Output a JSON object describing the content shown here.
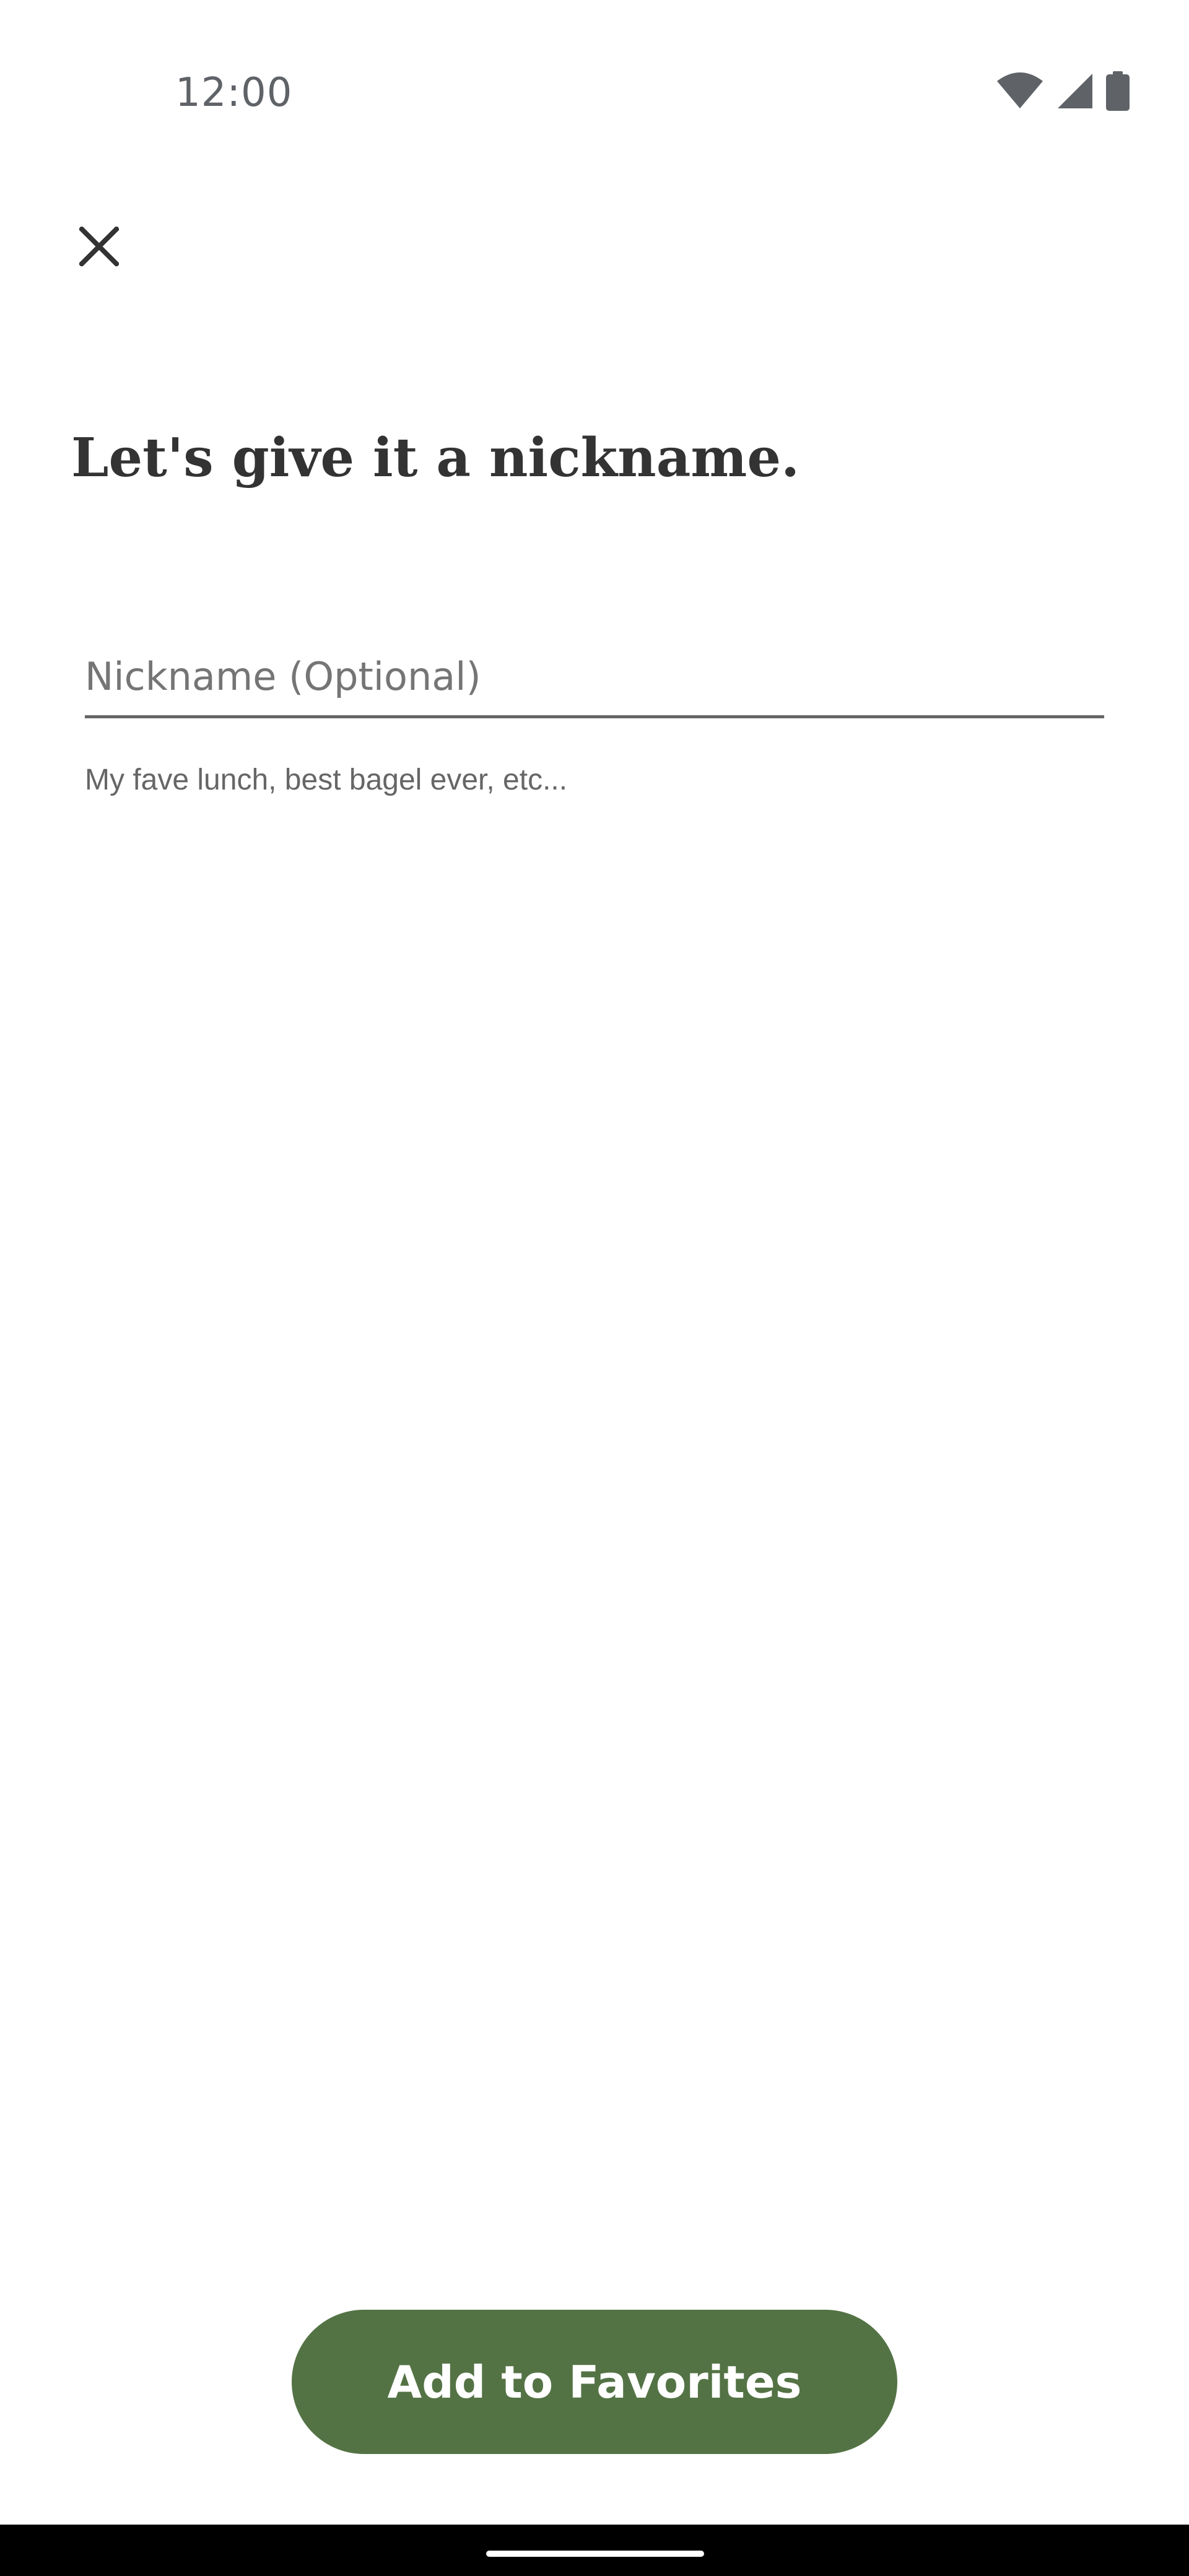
{
  "status_bar": {
    "time": "12:00",
    "icons": [
      "wifi-icon",
      "signal-icon",
      "battery-icon"
    ]
  },
  "header": {
    "close_icon": "close-icon"
  },
  "main": {
    "title": "Let's give it a nickname.",
    "nickname_input": {
      "value": "",
      "placeholder": "Nickname (Optional)"
    },
    "helper_text": "My fave lunch, best bagel ever, etc..."
  },
  "footer": {
    "add_button_label": "Add to Favorites"
  },
  "colors": {
    "primary_button": "#547345",
    "text": "#333333",
    "nav_bar": "#000000"
  }
}
